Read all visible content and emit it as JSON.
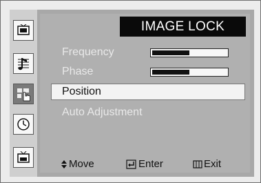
{
  "menu": {
    "title": "IMAGE LOCK",
    "items": [
      {
        "label": "Frequency",
        "level": 0.5
      },
      {
        "label": "Phase",
        "level": 0.5
      },
      {
        "label": "Position"
      },
      {
        "label": "Auto Adjustment"
      }
    ],
    "selected_item": "Position"
  },
  "sidebar_icons": [
    "picture-icon",
    "sound-icon",
    "setup-icon",
    "clock-icon",
    "input-icon"
  ],
  "active_sidebar_icon": "setup-icon",
  "footer": {
    "move_label": "Move",
    "enter_label": "Enter",
    "exit_label": "Exit"
  },
  "colors": {
    "title_bg": "#0a0a0a",
    "title_text": "#ffffff",
    "selected_bg": "#f3f3f3",
    "panel_bg": "#b0b0b0"
  }
}
